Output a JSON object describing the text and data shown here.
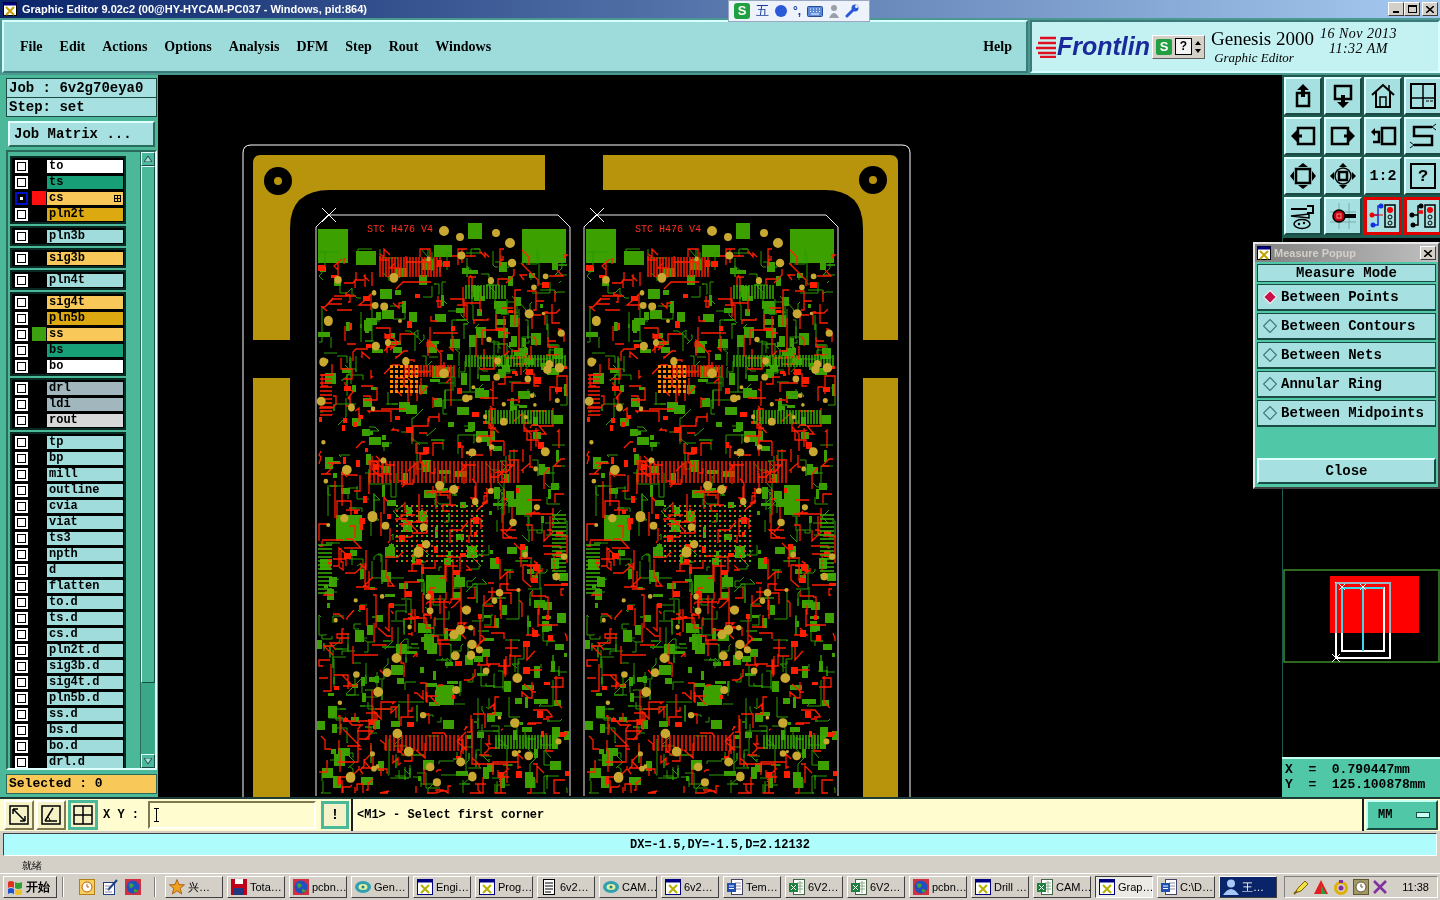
{
  "window": {
    "title": "Graphic Editor 9.02c2 (00@HY-HYCAM-PC037 - Windows, pid:864)"
  },
  "ime_bar": {
    "logo": "S",
    "mode": "五",
    "punctuation": "°,"
  },
  "menu": {
    "items": [
      "File",
      "Edit",
      "Actions",
      "Options",
      "Analysis",
      "DFM",
      "Step",
      "Rout",
      "Windows"
    ],
    "help": "Help"
  },
  "brand": {
    "logo": "Frontlin",
    "widget_logo": "S",
    "widget_help": "?",
    "product": "Genesis 2000",
    "subtitle": "Graphic Editor",
    "date": "16 Nov 2013",
    "time": "11:32 AM"
  },
  "job_panel": {
    "job": "Job : 6v2g70eya0",
    "step": "Step: set",
    "matrix_button": "Job Matrix ...",
    "selected_count": "Selected : 0"
  },
  "layer_groups": [
    {
      "layers": [
        {
          "name": "to",
          "color": "#ffffff",
          "active": false,
          "marked": false
        },
        {
          "name": "ts",
          "color": "#17a078",
          "active": false,
          "marked": false
        },
        {
          "name": "cs",
          "color": "#f8c858",
          "active": true,
          "marked": true,
          "swatch": {
            "color": "#ff1010"
          }
        },
        {
          "name": "pln2t",
          "color": "#dcaa10",
          "active": false,
          "marked": false
        }
      ]
    },
    {
      "layers": [
        {
          "name": "pln3b",
          "color": "#a0dcdc",
          "active": false,
          "marked": false
        }
      ]
    },
    {
      "layers": [
        {
          "name": "sig3b",
          "color": "#f8c858",
          "active": false,
          "marked": false
        }
      ]
    },
    {
      "layers": [
        {
          "name": "pln4t",
          "color": "#a0dcdc",
          "active": false,
          "marked": false
        }
      ]
    },
    {
      "layers": [
        {
          "name": "sig4t",
          "color": "#f8c858",
          "active": false,
          "marked": false
        },
        {
          "name": "pln5b",
          "color": "#dcaa10",
          "active": false,
          "marked": false
        },
        {
          "name": "ss",
          "color": "#f8c858",
          "active": false,
          "marked": false,
          "swatch": {
            "color": "#3ca010"
          }
        },
        {
          "name": "bs",
          "color": "#17a078",
          "active": false,
          "marked": false
        },
        {
          "name": "bo",
          "color": "#ffffff",
          "active": false,
          "marked": false
        }
      ]
    },
    {
      "layers": [
        {
          "name": "drl",
          "color": "#a2b6be",
          "active": false,
          "marked": false
        },
        {
          "name": "ldi",
          "color": "#a2b6be",
          "active": false,
          "marked": false
        },
        {
          "name": "rout",
          "color": "#d8d8d8",
          "active": false,
          "marked": false
        }
      ]
    },
    {
      "layers": [
        {
          "name": "tp",
          "color": "#a0dcdc",
          "active": false,
          "marked": false
        },
        {
          "name": "bp",
          "color": "#a0dcdc",
          "active": false,
          "marked": false
        },
        {
          "name": "mill",
          "color": "#a0dcdc",
          "active": false,
          "marked": false
        },
        {
          "name": "outline",
          "color": "#a0dcdc",
          "active": false,
          "marked": false
        },
        {
          "name": "cvia",
          "color": "#a0dcdc",
          "active": false,
          "marked": false
        },
        {
          "name": "viat",
          "color": "#a0dcdc",
          "active": false,
          "marked": false
        },
        {
          "name": "ts3",
          "color": "#a0dcdc",
          "active": false,
          "marked": false
        },
        {
          "name": "npth",
          "color": "#a0dcdc",
          "active": false,
          "marked": false
        },
        {
          "name": "d",
          "color": "#a0dcdc",
          "active": false,
          "marked": false
        },
        {
          "name": "flatten",
          "color": "#a0dcdc",
          "active": false,
          "marked": false
        },
        {
          "name": "to.d",
          "color": "#a0dcdc",
          "active": false,
          "marked": false
        },
        {
          "name": "ts.d",
          "color": "#a0dcdc",
          "active": false,
          "marked": false
        },
        {
          "name": "cs.d",
          "color": "#a0dcdc",
          "active": false,
          "marked": false
        },
        {
          "name": "pln2t.d",
          "color": "#a0dcdc",
          "active": false,
          "marked": false
        },
        {
          "name": "sig3b.d",
          "color": "#a0dcdc",
          "active": false,
          "marked": false
        },
        {
          "name": "sig4t.d",
          "color": "#a0dcdc",
          "active": false,
          "marked": false
        },
        {
          "name": "pln5b.d",
          "color": "#a0dcdc",
          "active": false,
          "marked": false
        },
        {
          "name": "ss.d",
          "color": "#a0dcdc",
          "active": false,
          "marked": false
        },
        {
          "name": "bs.d",
          "color": "#a0dcdc",
          "active": false,
          "marked": false
        },
        {
          "name": "bo.d",
          "color": "#a0dcdc",
          "active": false,
          "marked": false
        },
        {
          "name": "drl.d",
          "color": "#a0dcdc",
          "active": false,
          "marked": false
        }
      ]
    }
  ],
  "canvas": {
    "board_labels": [
      "STC  H476  V4",
      "STC  H476  V4"
    ]
  },
  "toolbar": [
    {
      "kind": "box-up",
      "on": false
    },
    {
      "kind": "box-down",
      "on": false
    },
    {
      "kind": "house",
      "on": false
    },
    {
      "kind": "panes",
      "on": false
    },
    {
      "kind": "box-left",
      "on": false
    },
    {
      "kind": "box-right",
      "on": false
    },
    {
      "kind": "undo",
      "on": false
    },
    {
      "kind": "s-curve",
      "on": false
    },
    {
      "kind": "expand",
      "on": false
    },
    {
      "kind": "center",
      "on": false
    },
    {
      "kind": "text",
      "label": "1:2",
      "on": false
    },
    {
      "kind": "boxed-text",
      "label": "?",
      "on": false
    },
    {
      "kind": "tools",
      "on": false
    },
    {
      "kind": "probe",
      "on": false
    },
    {
      "kind": "net",
      "on": true
    },
    {
      "kind": "net-alt",
      "on": true
    }
  ],
  "measure_popup": {
    "title": "Measure Popup",
    "heading": "Measure Mode",
    "options": [
      {
        "label": "Between Points",
        "selected": true
      },
      {
        "label": "Between Contours",
        "selected": false
      },
      {
        "label": "Between Nets",
        "selected": false
      },
      {
        "label": "Annular Ring",
        "selected": false
      },
      {
        "label": "Between Midpoints",
        "selected": false
      }
    ],
    "close": "Close"
  },
  "coordinates": {
    "x": "X  =  0.790447mm",
    "y": "Y  =  125.100878mm"
  },
  "command": {
    "tools": [
      {
        "kind": "diagonal",
        "selected": false
      },
      {
        "kind": "angle",
        "selected": false
      },
      {
        "kind": "grid",
        "selected": true
      }
    ],
    "xy_label": "X Y :",
    "confirm": "!",
    "prompt": "<M1> - Select first corner",
    "units": "MM"
  },
  "status": {
    "measure": "DX=-1.5,DY=-1.5,D=2.12132",
    "hint": "就绪"
  },
  "taskbar": {
    "start": "开始",
    "tasks": [
      {
        "label": "兴…",
        "kind": "star",
        "selected": false,
        "attention": false
      },
      {
        "label": "Tota…",
        "kind": "disk",
        "selected": false,
        "attention": false
      },
      {
        "label": "pcbn…",
        "kind": "globe",
        "selected": false,
        "attention": false
      },
      {
        "label": "Gen…",
        "kind": "swirl",
        "selected": false,
        "attention": false
      },
      {
        "label": "Engi…",
        "kind": "window",
        "selected": false,
        "attention": false
      },
      {
        "label": "Prog…",
        "kind": "window",
        "selected": false,
        "attention": false
      },
      {
        "label": "6v2…",
        "kind": "notepad",
        "selected": false,
        "attention": false
      },
      {
        "label": "CAM…",
        "kind": "swirl",
        "selected": false,
        "attention": false
      },
      {
        "label": "6v2…",
        "kind": "window",
        "selected": false,
        "attention": false
      },
      {
        "label": "Tem…",
        "kind": "document",
        "selected": false,
        "attention": false
      },
      {
        "label": "6V2…",
        "kind": "sheet",
        "selected": false,
        "attention": false
      },
      {
        "label": "6V2…",
        "kind": "sheet",
        "selected": false,
        "attention": false
      },
      {
        "label": "pcbn…",
        "kind": "globe",
        "selected": false,
        "attention": false
      },
      {
        "label": "Drill …",
        "kind": "window",
        "selected": false,
        "attention": false
      },
      {
        "label": "CAM…",
        "kind": "sheet",
        "selected": false,
        "attention": false
      },
      {
        "label": "Grap…",
        "kind": "window",
        "selected": true,
        "attention": false
      },
      {
        "label": "C:\\D…",
        "kind": "document",
        "selected": false,
        "attention": false
      },
      {
        "label": "王…",
        "kind": "user",
        "selected": false,
        "attention": true
      }
    ],
    "clock": "11:38"
  }
}
